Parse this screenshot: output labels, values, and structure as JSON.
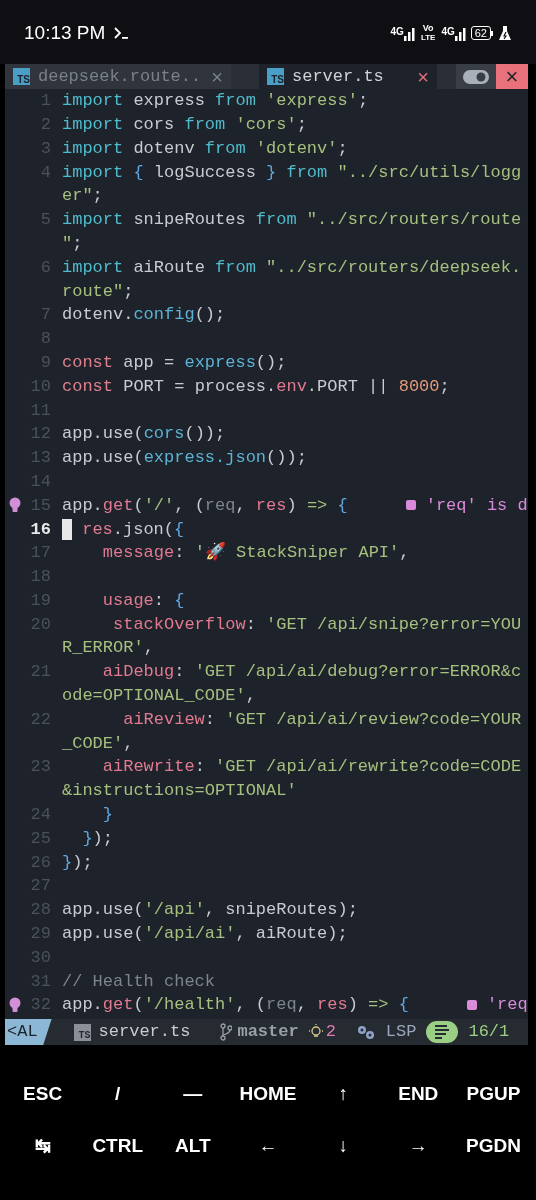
{
  "phone_status": {
    "time": "10:13 PM",
    "network_1": "4G",
    "volte": "Vo",
    "volte_sub": "LTE",
    "network_2": "4G",
    "battery": "62"
  },
  "tabs": [
    {
      "label": "deepseek.route..",
      "icon": "TS",
      "close": "×",
      "selected": false
    },
    {
      "label": "server.ts",
      "icon": "TS",
      "close": "×",
      "selected": true
    }
  ],
  "window_close": "×",
  "lines": [
    {
      "number": "1",
      "rows": [
        {
          "segments": [
            {
              "text": "import",
              "kind": "kw"
            },
            {
              "text": " express ",
              "kind": "id"
            },
            {
              "text": "from",
              "kind": "kw"
            },
            {
              "text": " 'express'",
              "kind": "str"
            },
            {
              "text": ";",
              "kind": "id"
            }
          ]
        }
      ]
    },
    {
      "number": "2",
      "rows": [
        {
          "segments": [
            {
              "text": "import",
              "kind": "kw"
            },
            {
              "text": " cors ",
              "kind": "id"
            },
            {
              "text": "from",
              "kind": "kw"
            },
            {
              "text": " 'cors'",
              "kind": "str"
            },
            {
              "text": ";",
              "kind": "id"
            }
          ]
        }
      ]
    },
    {
      "number": "3",
      "rows": [
        {
          "segments": [
            {
              "text": "import",
              "kind": "kw"
            },
            {
              "text": " dotenv ",
              "kind": "id"
            },
            {
              "text": "from",
              "kind": "kw"
            },
            {
              "text": " 'dotenv'",
              "kind": "str"
            },
            {
              "text": ";",
              "kind": "id"
            }
          ]
        }
      ]
    },
    {
      "number": "4",
      "rows": [
        {
          "segments": [
            {
              "text": "import",
              "kind": "kw"
            },
            {
              "text": " {",
              "kind": "brace"
            },
            {
              "text": " logSuccess ",
              "kind": "id"
            },
            {
              "text": "}",
              "kind": "brace"
            },
            {
              "text": " from",
              "kind": "kw"
            },
            {
              "text": " \"../src/utils/logg",
              "kind": "str"
            }
          ]
        },
        {
          "segments": [
            {
              "text": "er\"",
              "kind": "str"
            },
            {
              "text": ";",
              "kind": "id"
            }
          ]
        }
      ]
    },
    {
      "number": "5",
      "rows": [
        {
          "segments": [
            {
              "text": "import",
              "kind": "kw"
            },
            {
              "text": " snipeRoutes ",
              "kind": "id"
            },
            {
              "text": "from",
              "kind": "kw"
            },
            {
              "text": " \"../src/routers/route",
              "kind": "str"
            }
          ]
        },
        {
          "segments": [
            {
              "text": "\"",
              "kind": "str"
            },
            {
              "text": ";",
              "kind": "id"
            }
          ]
        }
      ]
    },
    {
      "number": "6",
      "rows": [
        {
          "segments": [
            {
              "text": "import",
              "kind": "kw"
            },
            {
              "text": " aiRoute ",
              "kind": "id"
            },
            {
              "text": "from",
              "kind": "kw"
            },
            {
              "text": " \"../src/routers/deepseek.",
              "kind": "str"
            }
          ]
        },
        {
          "segments": [
            {
              "text": "route\"",
              "kind": "str"
            },
            {
              "text": ";",
              "kind": "id"
            }
          ]
        }
      ]
    },
    {
      "number": "7",
      "rows": [
        {
          "segments": [
            {
              "text": "dotenv.",
              "kind": "id"
            },
            {
              "text": "config",
              "kind": "fn"
            },
            {
              "text": "();",
              "kind": "id"
            }
          ]
        }
      ]
    },
    {
      "number": "8",
      "rows": [
        {}
      ]
    },
    {
      "number": "9",
      "rows": [
        {
          "segments": [
            {
              "text": "const",
              "kind": "def"
            },
            {
              "text": " app = ",
              "kind": "id"
            },
            {
              "text": "express",
              "kind": "fn"
            },
            {
              "text": "();",
              "kind": "id"
            }
          ]
        }
      ]
    },
    {
      "number": "10",
      "rows": [
        {
          "segments": [
            {
              "text": "const",
              "kind": "def"
            },
            {
              "text": " PORT = process.",
              "kind": "id"
            },
            {
              "text": "env",
              "kind": "prop"
            },
            {
              "text": ".PORT || ",
              "kind": "id"
            },
            {
              "text": "8000",
              "kind": "num"
            },
            {
              "text": ";",
              "kind": "id"
            }
          ]
        }
      ]
    },
    {
      "number": "11",
      "rows": [
        {}
      ]
    },
    {
      "number": "12",
      "rows": [
        {
          "segments": [
            {
              "text": "app.use(",
              "kind": "id"
            },
            {
              "text": "cors",
              "kind": "fn"
            },
            {
              "text": "());",
              "kind": "id"
            }
          ]
        }
      ]
    },
    {
      "number": "13",
      "rows": [
        {
          "segments": [
            {
              "text": "app.use(",
              "kind": "id"
            },
            {
              "text": "express.json",
              "kind": "fn"
            },
            {
              "text": "());",
              "kind": "id"
            }
          ]
        }
      ]
    },
    {
      "number": "14",
      "rows": [
        {}
      ]
    },
    {
      "number": "15",
      "bulb": true,
      "diagnostic": "'req' is d",
      "rows": [
        {
          "segments": [
            {
              "text": "app.",
              "kind": "id"
            },
            {
              "text": "get",
              "kind": "prop"
            },
            {
              "text": "(",
              "kind": "id"
            },
            {
              "text": "'/'",
              "kind": "str"
            },
            {
              "text": ", (",
              "kind": "id"
            },
            {
              "text": "req",
              "kind": "unused"
            },
            {
              "text": ", ",
              "kind": "id"
            },
            {
              "text": "res",
              "kind": "prop"
            },
            {
              "text": ") ",
              "kind": "id"
            },
            {
              "text": "=>",
              "kind": "op"
            },
            {
              "text": " {",
              "kind": "brace"
            }
          ]
        }
      ]
    },
    {
      "number": "16",
      "current": true,
      "rows": [
        {
          "segments": [
            {
              "text": " res",
              "kind": "prop"
            },
            {
              "text": ".json(",
              "kind": "id"
            },
            {
              "text": "{",
              "kind": "brace"
            }
          ]
        }
      ]
    },
    {
      "number": "17",
      "rows": [
        {
          "segments": [
            {
              "text": "    message",
              "kind": "prop"
            },
            {
              "text": ": ",
              "kind": "id"
            },
            {
              "text": "'🚀 StackSniper API'",
              "kind": "str"
            },
            {
              "text": ",",
              "kind": "id"
            }
          ]
        }
      ]
    },
    {
      "number": "18",
      "rows": [
        {}
      ]
    },
    {
      "number": "19",
      "rows": [
        {
          "segments": [
            {
              "text": "    usage",
              "kind": "prop"
            },
            {
              "text": ": ",
              "kind": "id"
            },
            {
              "text": "{",
              "kind": "brace"
            }
          ]
        }
      ]
    },
    {
      "number": "20",
      "rows": [
        {
          "segments": [
            {
              "text": "     stackOverflow",
              "kind": "prop"
            },
            {
              "text": ": ",
              "kind": "id"
            },
            {
              "text": "'GET /api/snipe?error=YOU",
              "kind": "str"
            }
          ]
        },
        {
          "segments": [
            {
              "text": "R_ERROR'",
              "kind": "str"
            },
            {
              "text": ",",
              "kind": "id"
            }
          ]
        }
      ]
    },
    {
      "number": "21",
      "rows": [
        {
          "segments": [
            {
              "text": "    aiDebug",
              "kind": "prop"
            },
            {
              "text": ": ",
              "kind": "id"
            },
            {
              "text": "'GET /api/ai/debug?error=ERROR&c",
              "kind": "str"
            }
          ]
        },
        {
          "segments": [
            {
              "text": "ode=OPTIONAL_CODE'",
              "kind": "str"
            },
            {
              "text": ",",
              "kind": "id"
            }
          ]
        }
      ]
    },
    {
      "number": "22",
      "rows": [
        {
          "segments": [
            {
              "text": "      aiReview",
              "kind": "prop"
            },
            {
              "text": ": ",
              "kind": "id"
            },
            {
              "text": "'GET /api/ai/review?code=YOUR",
              "kind": "str"
            }
          ]
        },
        {
          "segments": [
            {
              "text": "_CODE'",
              "kind": "str"
            },
            {
              "text": ",",
              "kind": "id"
            }
          ]
        }
      ]
    },
    {
      "number": "23",
      "rows": [
        {
          "segments": [
            {
              "text": "    aiRewrite",
              "kind": "prop"
            },
            {
              "text": ": ",
              "kind": "id"
            },
            {
              "text": "'GET /api/ai/rewrite?code=CODE",
              "kind": "str"
            }
          ]
        },
        {
          "segments": [
            {
              "text": "&instructions=OPTIONAL'",
              "kind": "str"
            }
          ]
        }
      ]
    },
    {
      "number": "24",
      "rows": [
        {
          "segments": [
            {
              "text": "    }",
              "kind": "brace"
            }
          ]
        }
      ]
    },
    {
      "number": "25",
      "rows": [
        {
          "segments": [
            {
              "text": "  }",
              "kind": "brace"
            },
            {
              "text": ");",
              "kind": "id"
            }
          ]
        }
      ]
    },
    {
      "number": "26",
      "rows": [
        {
          "segments": [
            {
              "text": "}",
              "kind": "brace"
            },
            {
              "text": ");",
              "kind": "id"
            }
          ]
        }
      ]
    },
    {
      "number": "27",
      "rows": [
        {}
      ]
    },
    {
      "number": "28",
      "rows": [
        {
          "segments": [
            {
              "text": "app.use(",
              "kind": "id"
            },
            {
              "text": "'/api'",
              "kind": "str"
            },
            {
              "text": ", snipeRoutes);",
              "kind": "id"
            }
          ]
        }
      ]
    },
    {
      "number": "29",
      "rows": [
        {
          "segments": [
            {
              "text": "app.use(",
              "kind": "id"
            },
            {
              "text": "'/api/ai'",
              "kind": "str"
            },
            {
              "text": ", aiRoute);",
              "kind": "id"
            }
          ]
        }
      ]
    },
    {
      "number": "30",
      "rows": [
        {}
      ]
    },
    {
      "number": "31",
      "rows": [
        {
          "segments": [
            {
              "text": "// Health check",
              "kind": "comment"
            }
          ]
        }
      ]
    },
    {
      "number": "32",
      "bulb": true,
      "diagnostic": "'req",
      "rows": [
        {
          "segments": [
            {
              "text": "app.",
              "kind": "id"
            },
            {
              "text": "get",
              "kind": "prop"
            },
            {
              "text": "(",
              "kind": "id"
            },
            {
              "text": "'/health'",
              "kind": "str"
            },
            {
              "text": ", (",
              "kind": "id"
            },
            {
              "text": "req",
              "kind": "unused"
            },
            {
              "text": ", ",
              "kind": "id"
            },
            {
              "text": "res",
              "kind": "prop"
            },
            {
              "text": ") ",
              "kind": "id"
            },
            {
              "text": "=>",
              "kind": "op"
            },
            {
              "text": " {",
              "kind": "brace"
            }
          ]
        }
      ]
    }
  ],
  "statusline": {
    "mode": "<AL",
    "file_icon": "TS",
    "file": "server.ts",
    "branch": "master",
    "hints": "2",
    "lsp": "LSP",
    "position": "16/1"
  },
  "keys": [
    [
      "ESC",
      "/",
      "—",
      "HOME",
      "↑",
      "END",
      "PGUP"
    ],
    [
      "↹",
      "CTRL",
      "ALT",
      "←",
      "↓",
      "→",
      "PGDN"
    ]
  ]
}
